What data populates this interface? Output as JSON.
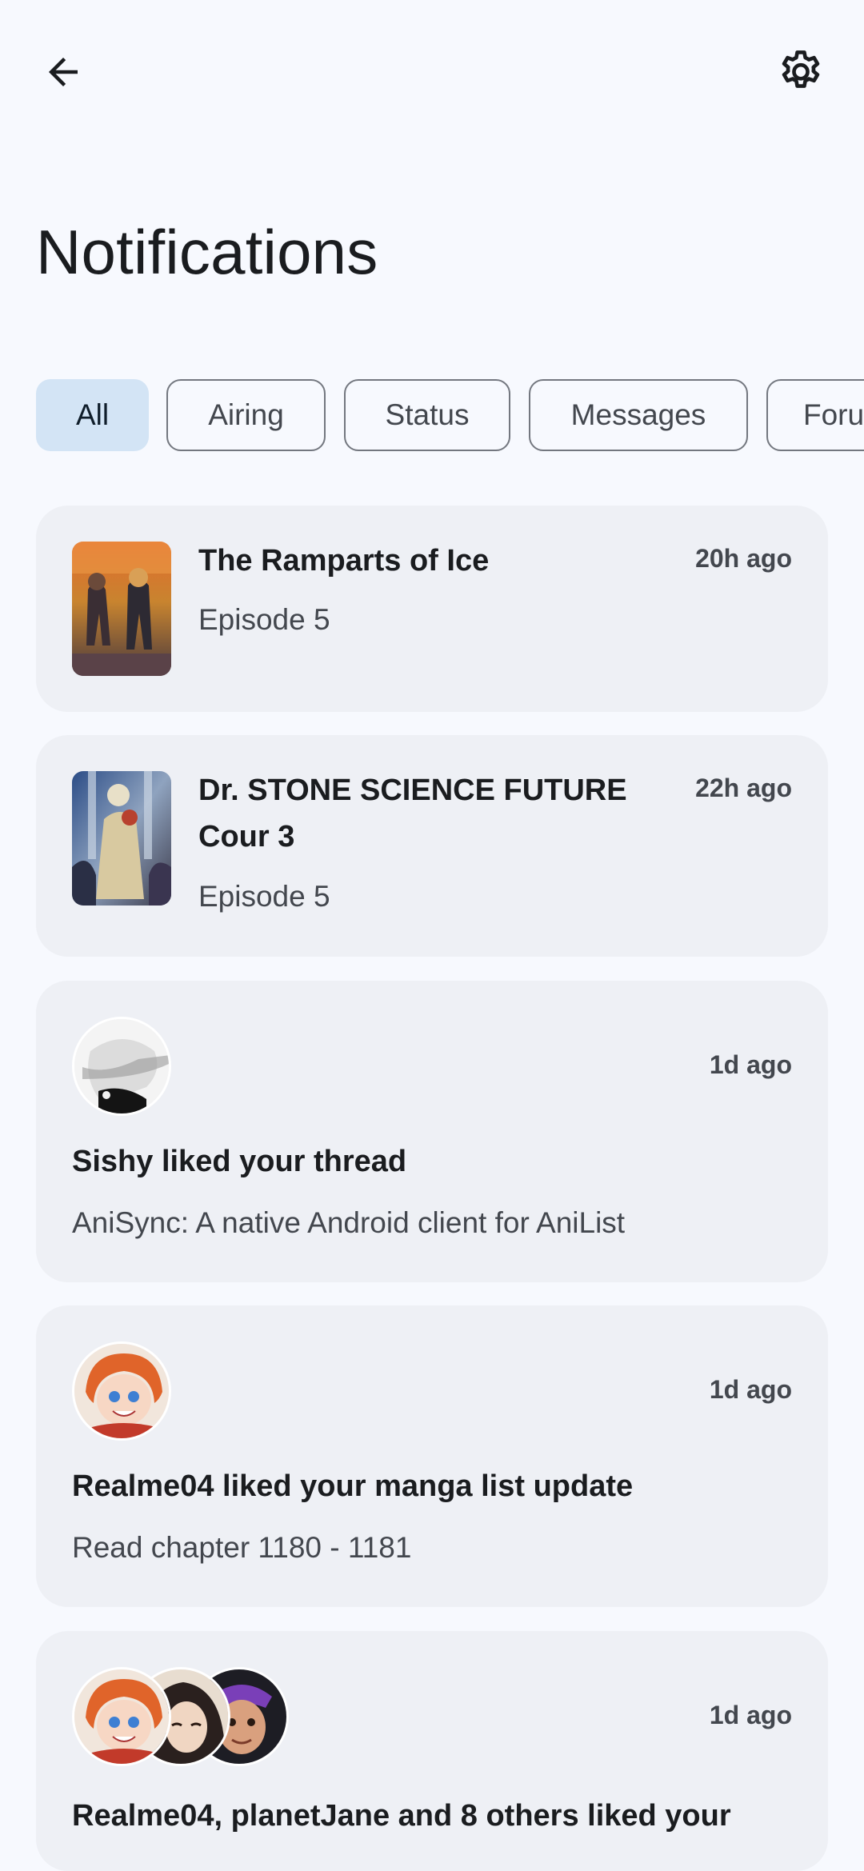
{
  "header": {
    "title": "Notifications"
  },
  "filters": {
    "chips": [
      {
        "label": "All",
        "selected": true
      },
      {
        "label": "Airing",
        "selected": false
      },
      {
        "label": "Status",
        "selected": false
      },
      {
        "label": "Messages",
        "selected": false
      },
      {
        "label": "Forums",
        "selected": false
      }
    ]
  },
  "notifications": [
    {
      "type": "airing",
      "title": "The Ramparts of Ice",
      "subtitle": "Episode 5",
      "time": "20h ago",
      "icon": "anime-cover"
    },
    {
      "type": "airing",
      "title": "Dr. STONE SCIENCE FUTURE Cour 3",
      "subtitle": "Episode 5",
      "time": "22h ago",
      "icon": "anime-cover"
    },
    {
      "type": "activity",
      "title": "Sishy liked your thread",
      "subtitle": "AniSync: A native Android client for AniList",
      "time": "1d ago",
      "icon": "user-avatar"
    },
    {
      "type": "activity",
      "title": "Realme04 liked your manga list update",
      "subtitle": "Read chapter 1180 - 1181",
      "time": "1d ago",
      "icon": "user-avatar"
    },
    {
      "type": "activity",
      "title": "Realme04, planetJane and 8 others liked your",
      "subtitle": "",
      "time": "1d ago",
      "icon": "user-avatars"
    }
  ],
  "colors": {
    "background": "#f7f9fe",
    "card": "#eef0f5",
    "selected_chip": "#d3e4f5",
    "chip_border": "#73777f"
  }
}
